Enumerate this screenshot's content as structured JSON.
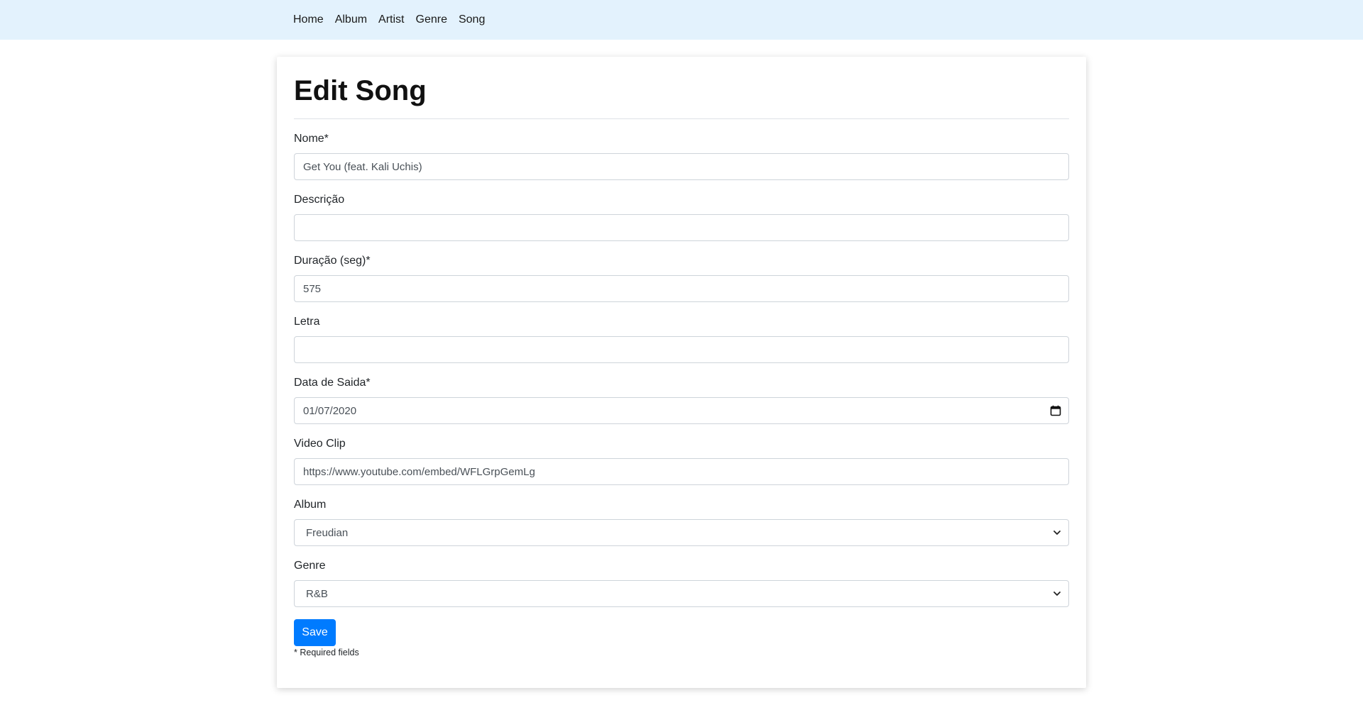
{
  "nav": {
    "items": [
      {
        "label": "Home"
      },
      {
        "label": "Album"
      },
      {
        "label": "Artist"
      },
      {
        "label": "Genre"
      },
      {
        "label": "Song"
      }
    ]
  },
  "form": {
    "title": "Edit Song",
    "fields": {
      "nome": {
        "label": "Nome*",
        "value": "Get You (feat. Kali Uchis)"
      },
      "descricao": {
        "label": "Descrição",
        "value": ""
      },
      "duracao": {
        "label": "Duração (seg)*",
        "value": "575"
      },
      "letra": {
        "label": "Letra",
        "value": ""
      },
      "data_saida": {
        "label": "Data de Saida*",
        "value": "01/07/2020",
        "icon": "calendar-icon"
      },
      "video_clip": {
        "label": "Video Clip",
        "value": "https://www.youtube.com/embed/WFLGrpGemLg"
      },
      "album": {
        "label": "Album",
        "value": "Freudian",
        "icon": "chevron-down-icon"
      },
      "genre": {
        "label": "Genre",
        "value": "R&B",
        "icon": "chevron-down-icon"
      }
    },
    "save_label": "Save",
    "required_note": "* Required fields"
  },
  "colors": {
    "navbar_bg": "#e3f2fd",
    "primary": "#007bff",
    "input_border": "#ced4da"
  }
}
